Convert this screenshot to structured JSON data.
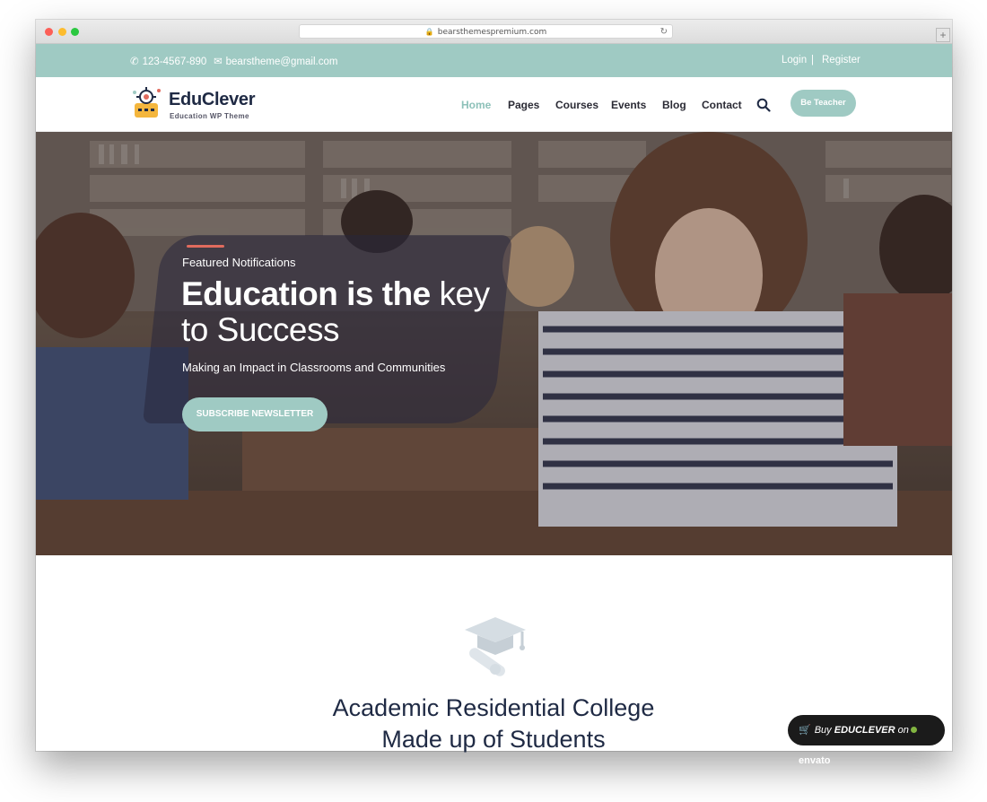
{
  "browser": {
    "url": "bearsthemespremium.com"
  },
  "topbar": {
    "phone": "123-4567-890",
    "email": "bearstheme@gmail.com",
    "login": "Login",
    "separator": "|",
    "register": "Register"
  },
  "header": {
    "brand": "EduClever",
    "tagline": "Education WP Theme",
    "nav": [
      "Home",
      "Pages",
      "Courses",
      "Events",
      "Blog",
      "Contact"
    ],
    "active_nav": "Home",
    "cta": "Be Teacher"
  },
  "hero": {
    "kicker": "Featured Notifications",
    "headline_bold": "Education is the",
    "headline_light_1": "key",
    "headline_light_2": "to Success",
    "subline": "Making an Impact in Classrooms and Communities",
    "button": "SUBSCRIBE NEWSLETTER"
  },
  "section": {
    "title_line1": "Academic Residential College",
    "title_line2": "Made up of Students"
  },
  "badge": {
    "prefix": "Buy",
    "product": "EDUCLEVER",
    "on": "on",
    "brand": "envato"
  },
  "colors": {
    "accent": "#9fcac3",
    "heading": "#1f2a44",
    "accent_line": "#e06b5e"
  }
}
